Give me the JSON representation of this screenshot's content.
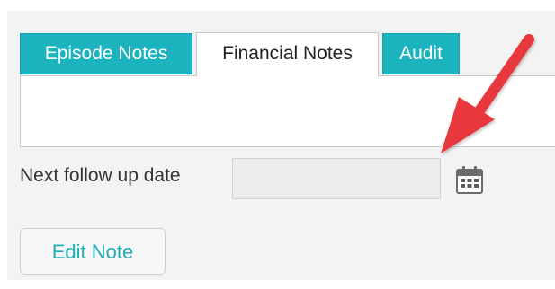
{
  "tabs": [
    {
      "label": "Episode Notes",
      "active": false
    },
    {
      "label": "Financial Notes",
      "active": true
    },
    {
      "label": "Audit",
      "active": false
    }
  ],
  "follow_up": {
    "label": "Next follow up date",
    "value": "",
    "placeholder": "",
    "icon": "calendar-icon"
  },
  "edit_button": {
    "label": "Edit Note"
  },
  "colors": {
    "tab_accent": "#1bb3bd",
    "button_text": "#1bafb9",
    "annotation_arrow": "#e8393d"
  }
}
